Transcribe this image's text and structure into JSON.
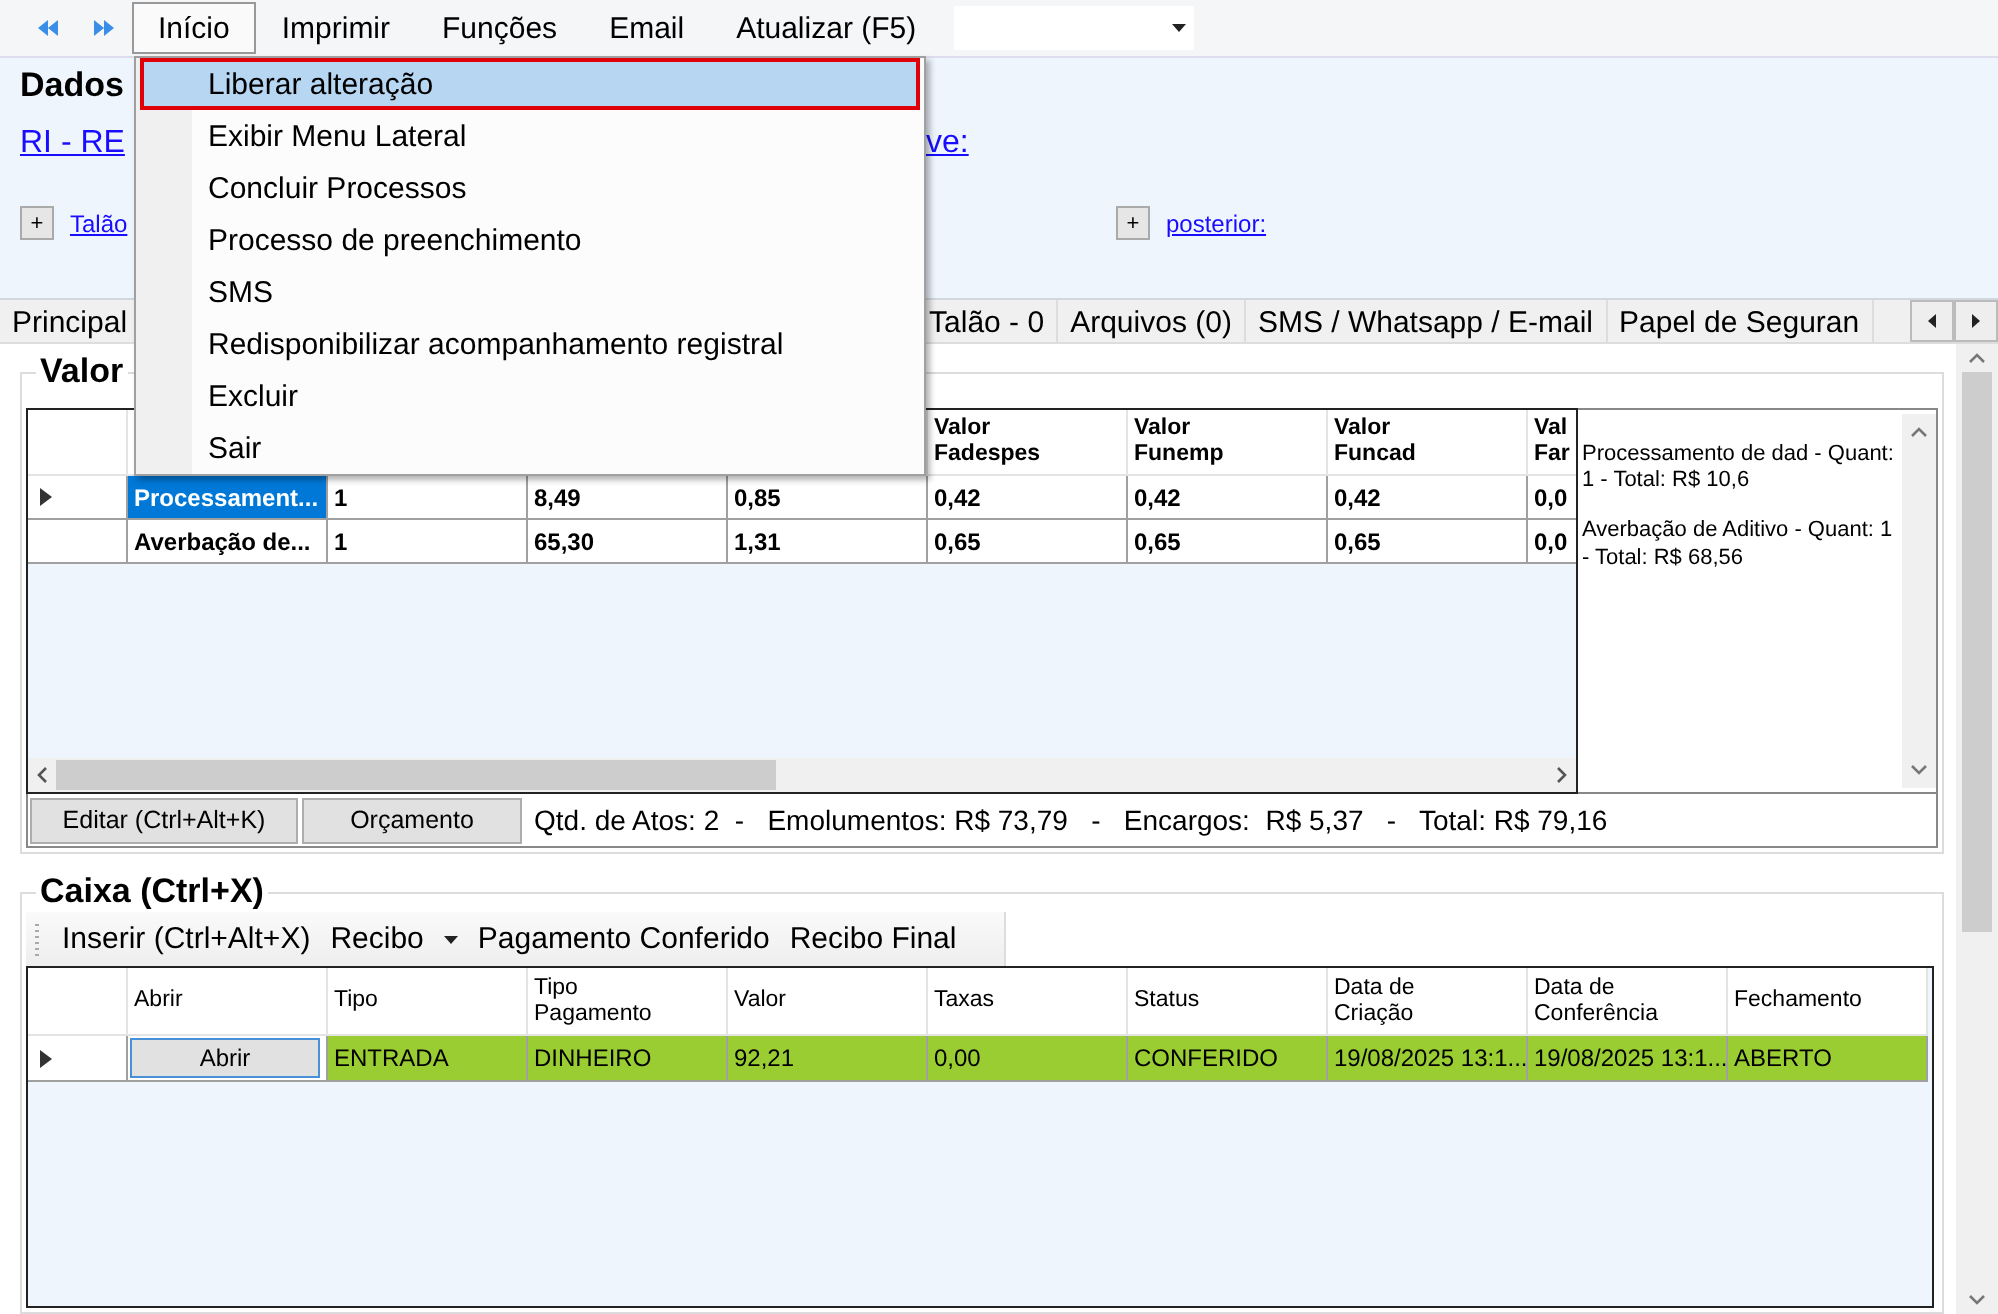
{
  "menu_bar": {
    "items": [
      {
        "label": "Início",
        "selected": true
      },
      {
        "label": "Imprimir",
        "selected": false
      },
      {
        "label": "Funções",
        "selected": false
      },
      {
        "label": "Email",
        "selected": false
      },
      {
        "label": "Atualizar (F5)",
        "selected": false
      }
    ]
  },
  "dropdown_menu": {
    "items": [
      {
        "label": "Liberar alteração",
        "selected": true
      },
      {
        "label": "Exibir Menu Lateral",
        "selected": false
      },
      {
        "label": "Concluir Processos",
        "selected": false
      },
      {
        "label": "Processo de preenchimento",
        "selected": false
      },
      {
        "label": "SMS",
        "selected": false
      },
      {
        "label": "Redisponibilizar acompanhamento registral",
        "selected": false
      },
      {
        "label": "Excluir",
        "selected": false
      },
      {
        "label": "Sair",
        "selected": false
      }
    ]
  },
  "header": {
    "title": "Dados",
    "link": "RI - RE",
    "link_end": "ve:",
    "expanders": [
      {
        "button": "+",
        "link": "Talão"
      },
      {
        "button": "+",
        "link": "posterior:"
      }
    ]
  },
  "tabs": [
    {
      "label": "Principal"
    },
    {
      "label": "Talão - 0"
    },
    {
      "label": "Arquivos (0)"
    },
    {
      "label": "SMS / Whatsapp / E-mail"
    },
    {
      "label": "Papel de Seguran"
    }
  ],
  "valores": {
    "title": "Valor",
    "columns": [
      "",
      "",
      "",
      "",
      "Valor\nFadespes",
      "Valor\nFunemp",
      "Valor\nFuncad",
      "Val\nFar"
    ],
    "rows": [
      {
        "selected": true,
        "cells": [
          "Processament...",
          "1",
          "8,49",
          "0,85",
          "0,42",
          "0,42",
          "0,42",
          "0,0"
        ]
      },
      {
        "selected": false,
        "cells": [
          "Averbação de...",
          "1",
          "65,30",
          "1,31",
          "0,65",
          "0,65",
          "0,65",
          "0,0"
        ]
      }
    ],
    "notes": [
      "Processamento de dad -  Quant: 1 - Total: R$ 10,6",
      "Averbação de Aditivo -  Quant: 1 - Total: R$ 68,56"
    ],
    "buttons": [
      "Editar (Ctrl+Alt+K)",
      "Orçamento"
    ],
    "totals": "Qtd. de Atos: 2  -   Emolumentos: R$ 73,79   -   Encargos:  R$ 5,37   -   Total: R$ 79,16"
  },
  "caixa": {
    "title": "Caixa (Ctrl+X)",
    "toolbar": [
      {
        "label": "Inserir (Ctrl+Alt+X)",
        "kind": "button"
      },
      {
        "label": "Recibo",
        "kind": "dropdown"
      },
      {
        "label": "Pagamento Conferido",
        "kind": "button"
      },
      {
        "label": "Recibo Final",
        "kind": "button"
      }
    ],
    "columns": [
      "Abrir",
      "Tipo",
      "Tipo\nPagamento",
      "Valor",
      "Taxas",
      "Status",
      "Data de\nCriação",
      "Data de\nConferência",
      "Fechamento"
    ],
    "rows": [
      {
        "selected": true,
        "color": "#9acd32",
        "cells": [
          {
            "kind": "button",
            "text": "Abrir"
          },
          {
            "kind": "text",
            "text": "ENTRADA"
          },
          {
            "kind": "text",
            "text": "DINHEIRO"
          },
          {
            "kind": "text",
            "text": "92,21"
          },
          {
            "kind": "text",
            "text": "0,00"
          },
          {
            "kind": "text",
            "text": "CONFERIDO"
          },
          {
            "kind": "text",
            "text": "19/08/2025 13:1..."
          },
          {
            "kind": "text",
            "text": "19/08/2025 13:1..."
          },
          {
            "kind": "text",
            "text": "ABERTO"
          }
        ]
      }
    ]
  }
}
